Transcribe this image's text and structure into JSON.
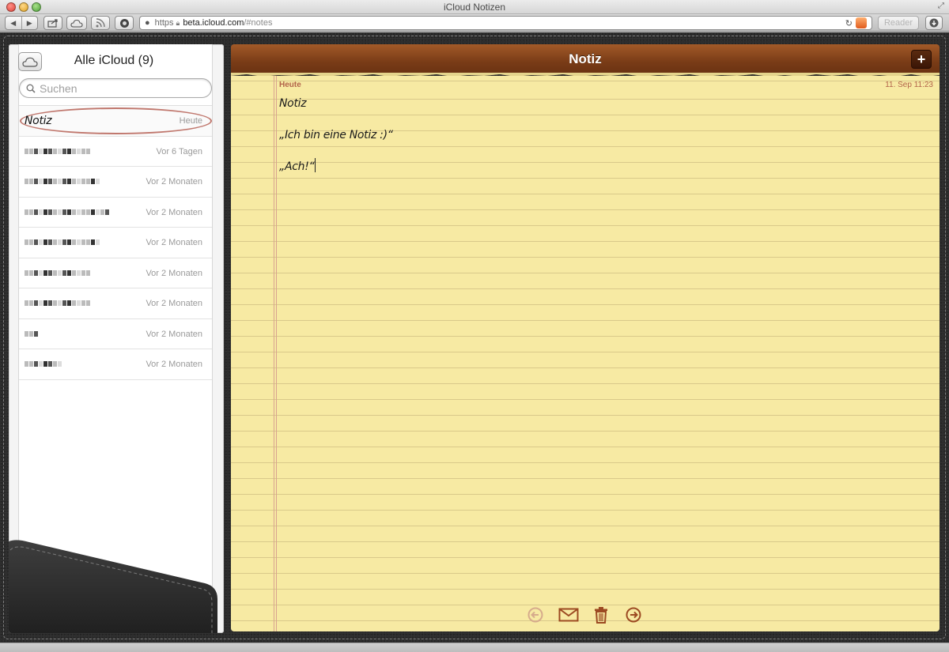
{
  "window": {
    "title": "iCloud Notizen"
  },
  "browser": {
    "url_scheme": "https",
    "url_host": "beta.icloud.com",
    "url_path": "/#notes",
    "reader_label": "Reader"
  },
  "sidebar": {
    "title": "Alle iCloud (9)",
    "search_placeholder": "Suchen",
    "notes": [
      {
        "title": "Notiz",
        "date": "Heute",
        "selected": true
      },
      {
        "title": "",
        "date": "Vor 6 Tagen"
      },
      {
        "title": "",
        "date": "Vor 2 Monaten"
      },
      {
        "title": "",
        "date": "Vor 2 Monaten"
      },
      {
        "title": "",
        "date": "Vor 2 Monaten"
      },
      {
        "title": "",
        "date": "Vor 2 Monaten"
      },
      {
        "title": "",
        "date": "Vor 2 Monaten"
      },
      {
        "title": "",
        "date": "Vor 2 Monaten"
      },
      {
        "title": "",
        "date": "Vor 2 Monaten"
      }
    ]
  },
  "note": {
    "header_title": "Notiz",
    "add_label": "+",
    "day_label": "Heute",
    "timestamp": "11. Sep 11:23",
    "lines": [
      "Notiz",
      "„Ich bin eine Notiz :)“",
      "„Ach!“"
    ]
  },
  "colors": {
    "paper": "#f7eaa3",
    "header_brown": "#7a3c17",
    "accent_red": "#b2644a"
  }
}
